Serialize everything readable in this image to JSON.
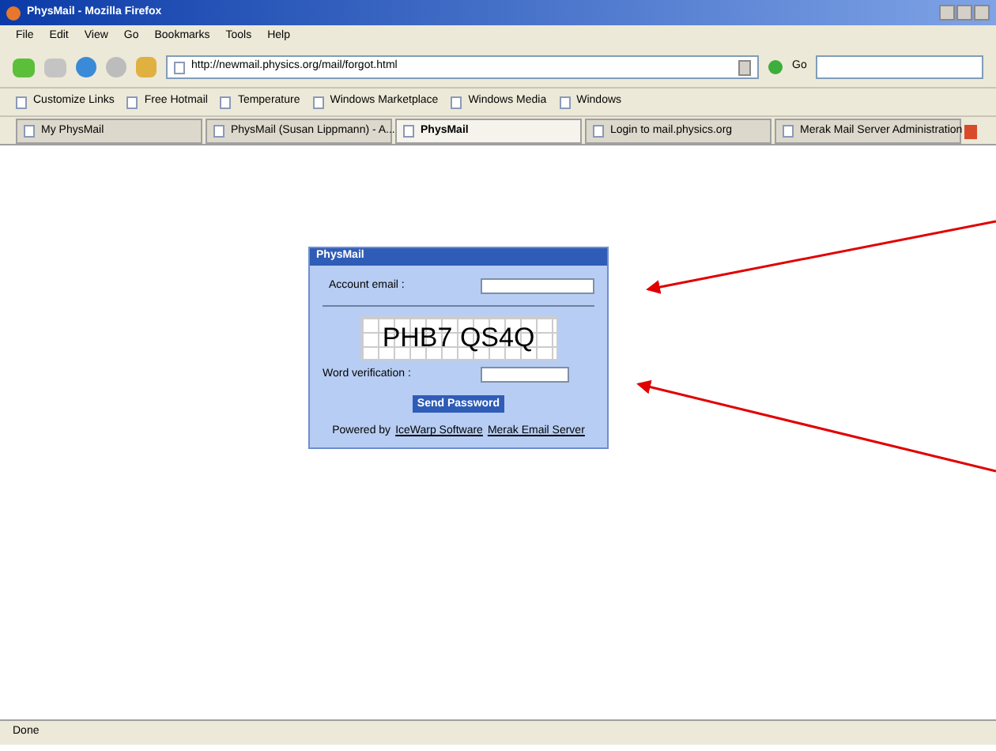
{
  "window": {
    "title": "PhysMail - Mozilla Firefox"
  },
  "menu": [
    "File",
    "Edit",
    "View",
    "Go",
    "Bookmarks",
    "Tools",
    "Help"
  ],
  "address_bar": {
    "value": "http://newmail.physics.org/mail/forgot.html"
  },
  "go_button": "Go",
  "bookmarks": [
    "Customize Links",
    "Free Hotmail",
    "Temperature",
    "Windows Marketplace",
    "Windows Media",
    "Windows"
  ],
  "tabs": [
    {
      "label": "My PhysMail",
      "selected": false
    },
    {
      "label": "PhysMail (Susan Lippmann) - A...",
      "selected": false
    },
    {
      "label": "PhysMail",
      "selected": true
    },
    {
      "label": "Login to mail.physics.org",
      "selected": false
    },
    {
      "label": "Merak Mail Server Administration",
      "selected": false
    }
  ],
  "dialog": {
    "title": "PhysMail",
    "email_label": "Account email :",
    "captcha": "PHB7 QS4Q",
    "verification_label": "Word verification :",
    "button": "Send Password",
    "footer_prefix": "Powered by",
    "footer_links": [
      "IceWarp Software",
      "Merak Email Server"
    ]
  },
  "status_bar": "Done"
}
